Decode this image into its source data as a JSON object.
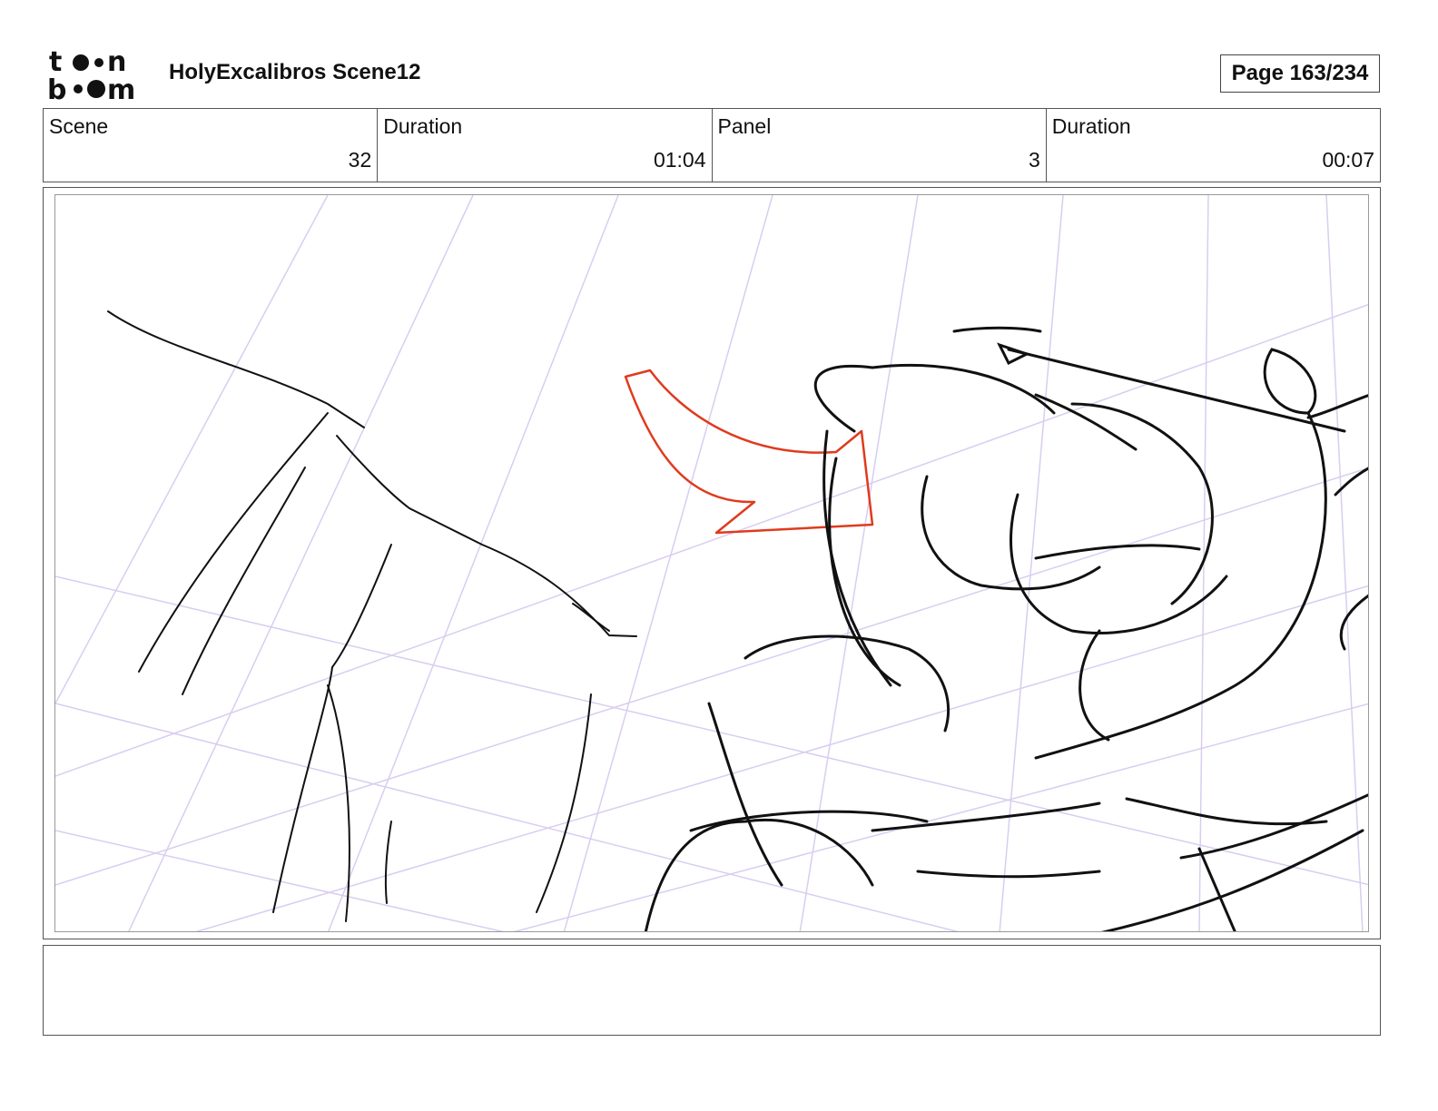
{
  "header": {
    "logo_icon": "toonboom-logo",
    "project_title": "HolyExcalibros Scene12",
    "page_label": "Page 163/234"
  },
  "info": {
    "scene_label": "Scene",
    "scene_value": "32",
    "scene_duration_label": "Duration",
    "scene_duration_value": "01:04",
    "panel_label": "Panel",
    "panel_value": "3",
    "panel_duration_label": "Duration",
    "panel_duration_value": "00:07"
  },
  "panel": {
    "sketch_icon": "storyboard-sketch",
    "arrow_color": "#e03a1e",
    "grid_color": "#d9cdf0",
    "ink_color": "#111111"
  },
  "caption": {
    "text": ""
  }
}
